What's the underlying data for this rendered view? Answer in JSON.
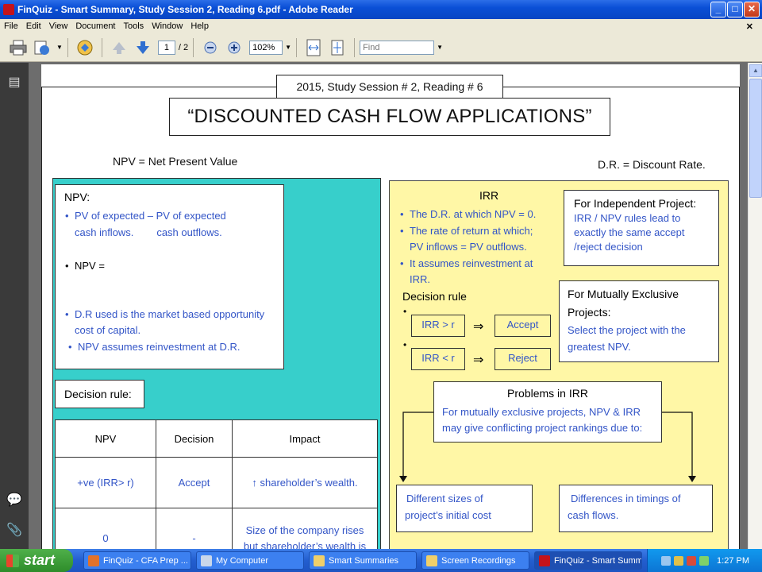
{
  "window": {
    "title": "FinQuiz - Smart Summary, Study Session 2, Reading 6.pdf - Adobe Reader",
    "controls": {
      "minimize": "_",
      "maximize": "□",
      "close": "✕"
    }
  },
  "menu": [
    "File",
    "Edit",
    "View",
    "Document",
    "Tools",
    "Window",
    "Help"
  ],
  "toolbar": {
    "page_current": "1",
    "page_total": "/ 2",
    "zoom": "102%",
    "find_placeholder": "Find"
  },
  "document": {
    "session_box": "2015, Study Session # 2, Reading # 6",
    "title": "“DISCOUNTED CASH FLOW APPLICATIONS”",
    "npv_legend": "NPV = Net Present Value",
    "dr_legend": "D.R. = Discount Rate.",
    "npv_box": {
      "heading": "NPV:",
      "b1_line1": "PV of expected – PV of expected",
      "b1_line2": "cash inflows.        cash outflows.",
      "b2": "NPV =",
      "b3_line1": "D.R used is the market based opportunity",
      "b3_line2": "cost of capital.",
      "b4": "NPV assumes reinvestment at D.R."
    },
    "decision_rule_label": "Decision rule:",
    "table": {
      "headers": [
        "NPV",
        "Decision",
        "Impact"
      ],
      "rows": [
        [
          "+ve (IRR> r)",
          "Accept",
          "↑ shareholder’s wealth."
        ],
        [
          "0",
          "-",
          "Size of the company rises but shareholder’s wealth is"
        ]
      ]
    },
    "irr": {
      "heading": "IRR",
      "b1": "The D.R. at which NPV = 0.",
      "b2_line1": "The rate of return at which;",
      "b2_line2": "PV inflows = PV outflows.",
      "b3_line1": "It assumes reinvestment at",
      "b3_line2": "IRR.",
      "decision_rule": "Decision rule",
      "cond1": "IRR > r",
      "result1": "Accept",
      "cond2": "IRR < r",
      "result2": "Reject",
      "implies": "⇒"
    },
    "independent": {
      "heading": "For Independent Project:",
      "body_line1": "IRR / NPV rules lead to",
      "body_line2": "exactly the same accept",
      "body_line3": "/reject decision"
    },
    "mutually_exclusive": {
      "heading_line1": "For Mutually Exclusive",
      "heading_line2": "Projects:",
      "body_line1": "Select the project with the",
      "body_line2": "greatest NPV."
    },
    "problems": {
      "heading": "Problems in IRR",
      "body_line1": "For mutually exclusive projects, NPV & IRR",
      "body_line2": "may give conflicting project rankings due to:"
    },
    "diff_sizes": {
      "line1": "Different sizes of",
      "line2": "project’s initial cost"
    },
    "diff_timings": {
      "line1": "Differences in timings of",
      "line2": "cash flows."
    }
  },
  "taskbar": {
    "start": "start",
    "tasks": [
      "FinQuiz - CFA Prep ...",
      "My Computer",
      "Smart Summaries",
      "Screen Recordings",
      "FinQuiz - Smart Summ..."
    ],
    "time": "1:27 PM"
  },
  "colors": {
    "teal": "#37cfcb",
    "yellow": "#fff7a6",
    "blue_text": "#3355c7",
    "titlebar": "#0a4fd6"
  }
}
